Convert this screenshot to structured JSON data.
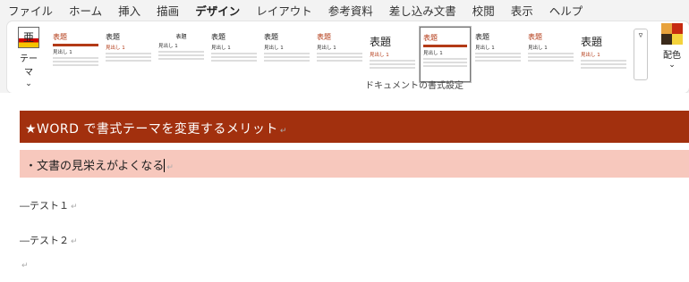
{
  "menu": {
    "items": [
      "ファイル",
      "ホーム",
      "挿入",
      "描画",
      "デザイン",
      "レイアウト",
      "参考資料",
      "差し込み文書",
      "校閲",
      "表示",
      "ヘルプ"
    ],
    "active_index": 4
  },
  "ribbon": {
    "theme_label": "テーマ",
    "theme_glyph": "亜",
    "styles": [
      {
        "title": "表題",
        "sub": "見出し 1",
        "variant": "red-bar"
      },
      {
        "title": "表題",
        "sub": "見出し 1",
        "variant": "plain-red"
      },
      {
        "title": "表題",
        "sub": "見出し 1",
        "variant": "center"
      },
      {
        "title": "表題",
        "sub": "見出し 1",
        "variant": "plain"
      },
      {
        "title": "表題",
        "sub": "見出し 1",
        "variant": "plain"
      },
      {
        "title": "表題",
        "sub": "見出し 1",
        "variant": "red"
      },
      {
        "title": "表題",
        "sub": "見出し 1",
        "variant": "big"
      },
      {
        "title": "表題",
        "sub": "見出し 1",
        "variant": "selected"
      },
      {
        "title": "表題",
        "sub": "見出し 1",
        "variant": "plain"
      },
      {
        "title": "表題",
        "sub": "見出し 1",
        "variant": "red"
      },
      {
        "title": "表題",
        "sub": "見出し 1",
        "variant": "big"
      }
    ],
    "group_label": "ドキュメントの書式設定",
    "colors_label": "配色",
    "color_swatches": [
      "#e8a23c",
      "#c62a10",
      "#3a2a1a",
      "#f4d23c"
    ]
  },
  "document": {
    "heading1": "★WORD で書式テーマを変更するメリット",
    "heading2": "・文書の見栄えがよくなる",
    "para1": "―テスト１",
    "para2": "―テスト２",
    "para_mark": "↵"
  }
}
